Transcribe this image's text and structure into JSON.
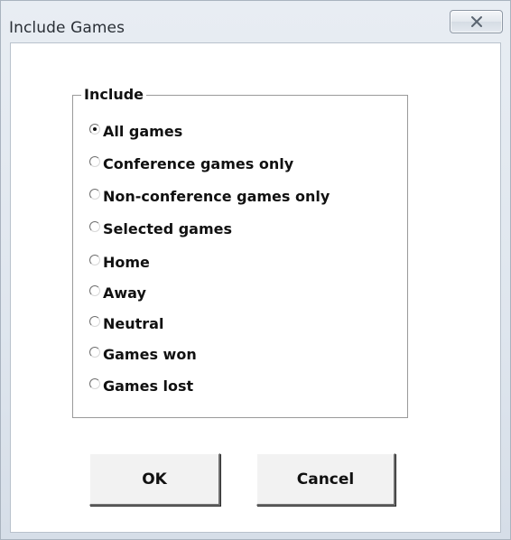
{
  "window": {
    "title": "Include Games"
  },
  "titlebar": {
    "close_icon": "close-icon"
  },
  "group": {
    "label": "Include",
    "selected_index": 0,
    "options": [
      {
        "label": "All games",
        "checked": true
      },
      {
        "label": "Conference games only",
        "checked": false
      },
      {
        "label": "Non-conference games only",
        "checked": false
      },
      {
        "label": "Selected games",
        "checked": false
      },
      {
        "label": "Home",
        "checked": false
      },
      {
        "label": "Away",
        "checked": false
      },
      {
        "label": "Neutral",
        "checked": false
      },
      {
        "label": "Games won",
        "checked": false
      },
      {
        "label": "Games lost",
        "checked": false
      }
    ]
  },
  "buttons": {
    "ok_label": "OK",
    "cancel_label": "Cancel"
  }
}
